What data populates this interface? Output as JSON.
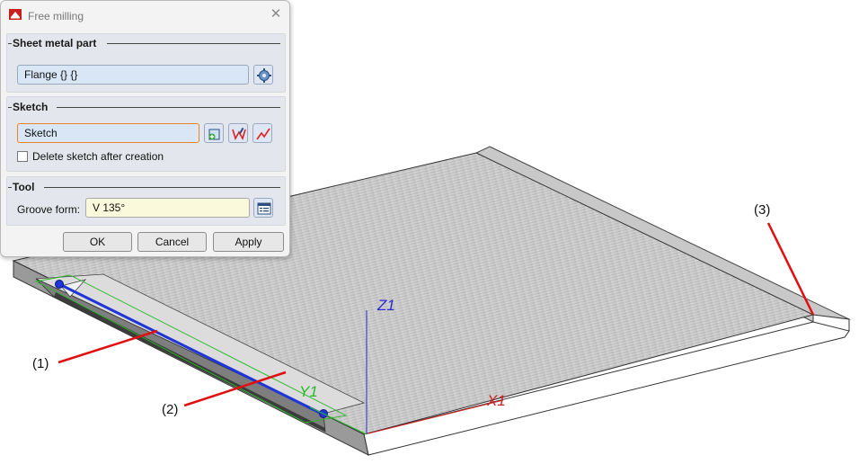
{
  "dialog": {
    "title": "Free milling",
    "close_symbol": "✕",
    "sheet_metal_part": {
      "heading": "Sheet metal part",
      "value": "Flange {} {}"
    },
    "sketch": {
      "heading": "Sketch",
      "value": "Sketch",
      "delete_checkbox_label": "Delete sketch after creation",
      "delete_checked": false
    },
    "tool": {
      "heading": "Tool",
      "groove_form_label": "Groove form:",
      "groove_form_value": "V 135°"
    },
    "buttons": {
      "ok": "OK",
      "cancel": "Cancel",
      "apply": "Apply"
    }
  },
  "viewport": {
    "axis_labels": {
      "z": "Z1",
      "x": "X1",
      "y": "Y1"
    },
    "callouts": {
      "one": "(1)",
      "two": "(2)",
      "three": "(3)"
    },
    "colors": {
      "sketch_line": "#1f35d6",
      "callout_leader": "#e01010",
      "z_axis": "#2a2ad0",
      "x_axis": "#d02020",
      "y_axis": "#27b927"
    }
  }
}
